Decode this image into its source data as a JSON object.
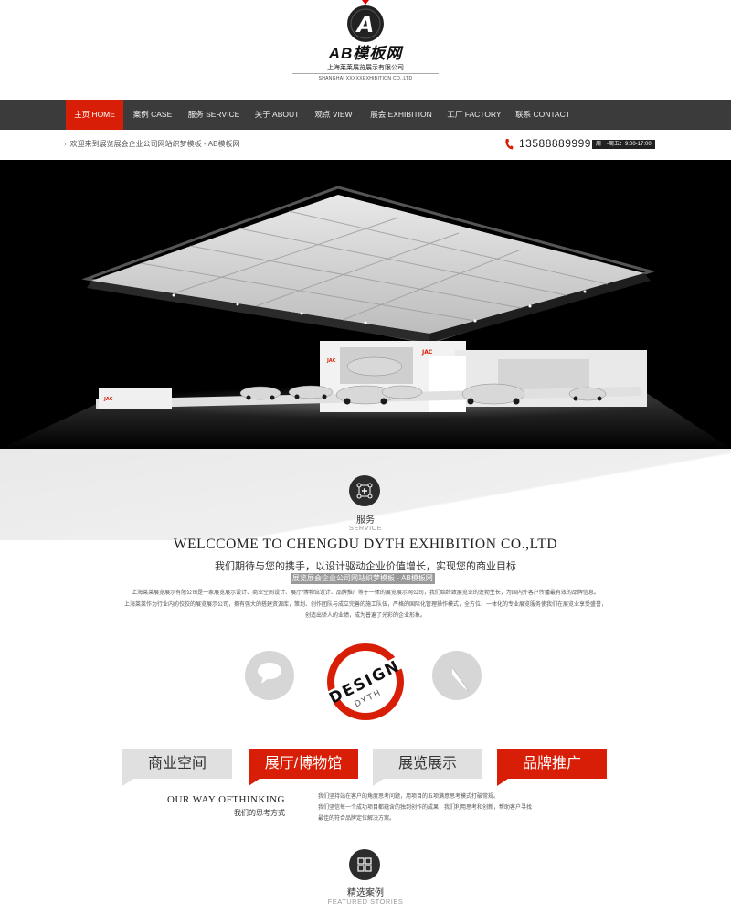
{
  "brand": {
    "logo_letter": "A",
    "name": "AB模板网",
    "company_cn": "上海莱莱展览展示有限公司",
    "company_en": "SHANGHAI XXXXXEXHIBITION CO.,LTD",
    "accent_color": "#d81e06"
  },
  "nav": {
    "items": [
      {
        "label": "主页  HOME",
        "active": true
      },
      {
        "label": "案例  CASE"
      },
      {
        "label": "服务  SERVICE"
      },
      {
        "label": "关于  ABOUT"
      },
      {
        "label": "观点  VIEW"
      },
      {
        "label": "展会  EXHIBITION"
      },
      {
        "label": "工厂  FACTORY"
      },
      {
        "label": "联系  CONTACT"
      }
    ]
  },
  "infobar": {
    "welcome": "欢迎来到展览展会企业公司网站织梦模板 - AB模板网",
    "phone": "13588889999",
    "hours": "周一-周五：9:00-17:00",
    "phone_icon": "phone-icon"
  },
  "banner": {
    "booth_brand": "JAC"
  },
  "service": {
    "icon": "network-icon",
    "title": "服务",
    "subtitle": "SERVICE",
    "heading": "WELCCOME TO  CHENGDU  DYTH  EXHIBITION CO.,LTD",
    "slogan": "我们期待与您的携手，以设计驱动企业价值增长，实现您的商业目标",
    "highlight": "展览展会企业公司网站织梦模板 - AB模板网",
    "body_lines": [
      "上海莱莱展览展示有限公司是一家展览展示设计、商业空间设计、展厅/博物馆设计、品牌推广等于一体的展览展示网公司，我们始终致展览业的蓬勃生长，为国内外客户传播最有效的品牌信息。",
      "上海莱莱作为行业内的佼佼的展览展示公司，拥有强大的搭建资源库，策划、创作团队与成立完善的施工队伍，严格的国际化管理操作模式，全方位、一体化的专业展览服务使我们在展览业享受盛誉，",
      "创造出骄人的业绩，成为普遍了光彩的企业形象。"
    ],
    "badge_main": "DESIGN",
    "badge_sub": "DYTH",
    "left_circle_icon": "speech-bubble-icon",
    "right_circle_icon": "pen-nib-icon"
  },
  "tabs": [
    {
      "label": "商业空间",
      "style": "gray"
    },
    {
      "label": "展厅/博物馆",
      "style": "red"
    },
    {
      "label": "展览展示",
      "style": "gray"
    },
    {
      "label": "品牌推广",
      "style": "red"
    }
  ],
  "way": {
    "title_en": "OUR WAY OFTHINKING",
    "title_cn": "我们的思考方式",
    "lines": [
      "我们坚持站在客户的角度思考问题，用项目的五项满意思考模式打破常规。",
      "我们坚信每一个成功项目都蕴含的独到创作的成果，我们利用思考和创新，帮助客户寻找",
      "最佳的符合品牌定位解决方案。"
    ]
  },
  "featured": {
    "icon": "grid-icon",
    "title": "精选案例",
    "subtitle": "FEATURED STORIES"
  }
}
